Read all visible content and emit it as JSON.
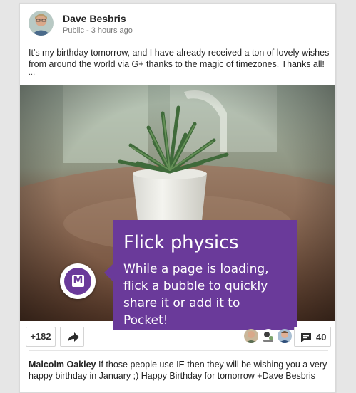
{
  "post": {
    "author": "Dave Besbris",
    "visibility": "Public",
    "separator": " - ",
    "time": "3 hours ago",
    "text": "It's my birthday tomorrow, and I have already received a ton of lovely wishes from around the world via G+ thanks to the magic of timezones. Thanks all!",
    "more": "..."
  },
  "tooltip": {
    "title": "Flick physics",
    "body": "While a page is loading, flick a bubble to quickly share it or add it to Pocket!"
  },
  "bubble": {
    "letter": "M"
  },
  "actions": {
    "plus_label": "+182",
    "comments_count": "40"
  },
  "comment": {
    "author": "Malcolm Oakley",
    "text": " If those people use IE then they will be wishing you a very happy birthday in January ;) Happy Birthday for tomorrow +Dave Besbris"
  },
  "colors": {
    "accent_purple": "#6a3a9a",
    "card_bg": "#ffffff",
    "page_bg": "#e6e6e6"
  },
  "icons": [
    "share-arrow-icon",
    "comment-icon",
    "pocket-logo-icon"
  ]
}
